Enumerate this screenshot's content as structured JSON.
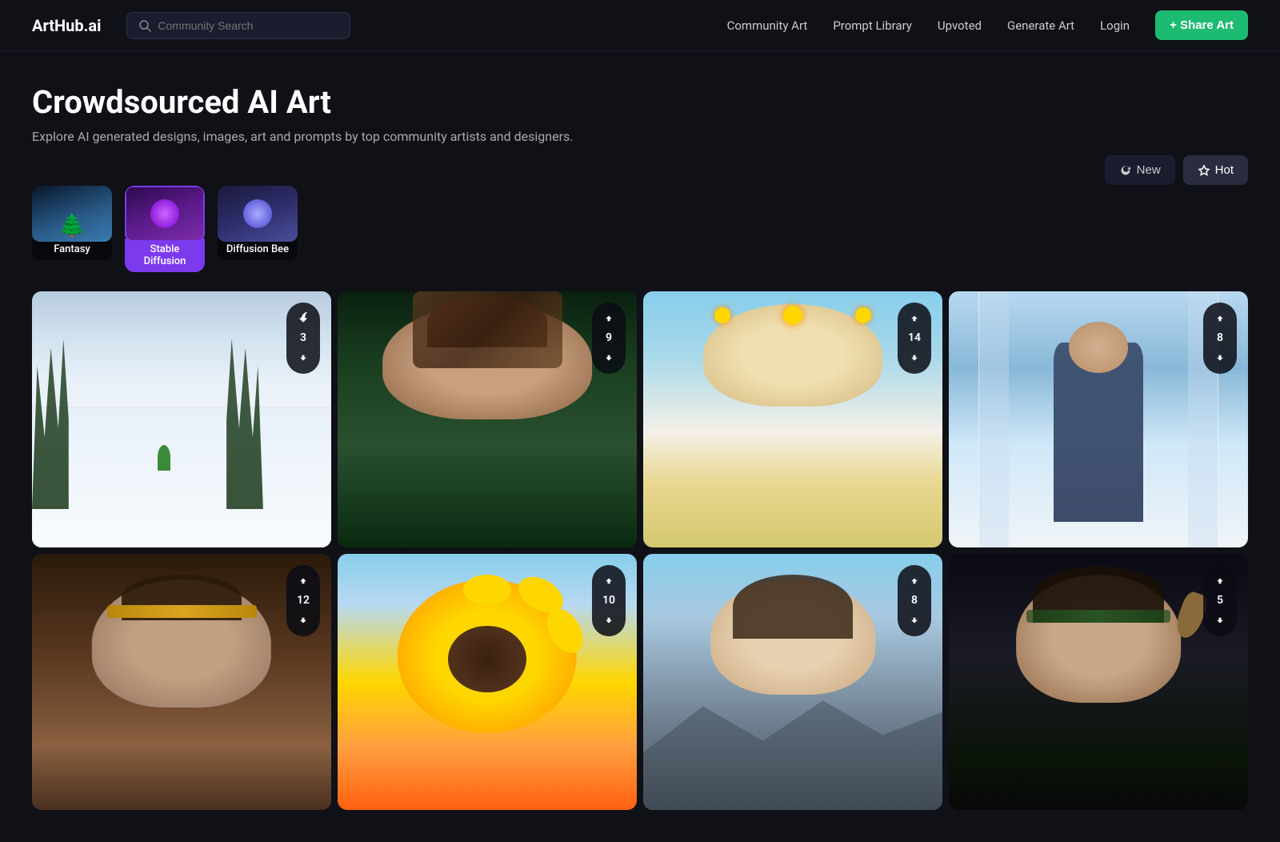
{
  "header": {
    "logo": "ArtHub.ai",
    "search_placeholder": "Community Search",
    "nav_items": [
      {
        "label": "Community Art",
        "id": "community-art"
      },
      {
        "label": "Prompt Library",
        "id": "prompt-library"
      },
      {
        "label": "Upvoted",
        "id": "upvoted"
      },
      {
        "label": "Generate Art",
        "id": "generate-art"
      },
      {
        "label": "Login",
        "id": "login"
      }
    ],
    "share_btn": "+ Share Art"
  },
  "hero": {
    "title": "Crowdsourced AI Art",
    "subtitle": "Explore AI generated designs, images, art and prompts by top community artists and designers."
  },
  "sort": {
    "new_label": "New",
    "hot_label": "Hot"
  },
  "categories": [
    {
      "id": "fantasy",
      "label": "Fantasy",
      "type": "fantasy",
      "selected": false
    },
    {
      "id": "stable-diffusion",
      "label": "Stable Diffusion",
      "type": "stable",
      "selected": true
    },
    {
      "id": "diffusion-bee",
      "label": "Diffusion Bee",
      "type": "diffusion",
      "selected": false
    }
  ],
  "gallery": [
    {
      "id": 1,
      "upvotes": 3,
      "type": "ski",
      "alt": "Ski slope winter scene"
    },
    {
      "id": 2,
      "upvotes": 9,
      "type": "woman1",
      "alt": "Woman portrait outdoor"
    },
    {
      "id": 3,
      "upvotes": 14,
      "type": "sunflower-girl",
      "alt": "Girl with sunflower crown"
    },
    {
      "id": 4,
      "upvotes": 8,
      "type": "mirror-girl",
      "alt": "Girl in blue dress mirror hall"
    },
    {
      "id": 5,
      "upvotes": 12,
      "type": "warrior",
      "alt": "Female warrior portrait"
    },
    {
      "id": 6,
      "upvotes": 10,
      "type": "sunflower2",
      "alt": "Sunflower girl sky"
    },
    {
      "id": 7,
      "upvotes": 8,
      "type": "mountain-girl",
      "alt": "Girl mountain background"
    },
    {
      "id": 8,
      "upvotes": 5,
      "type": "dark-girl",
      "alt": "Dark fantasy girl portrait"
    }
  ]
}
